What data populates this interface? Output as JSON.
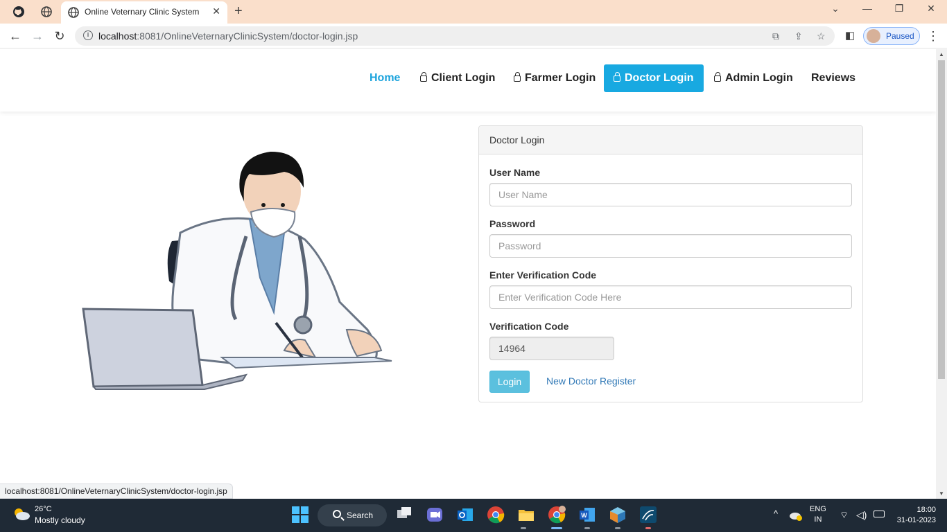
{
  "browser": {
    "tab_title": "Online Veternary Clinic System",
    "url_host": "localhost",
    "url_rest": ":8081/OnlineVeternaryClinicSystem/doctor-login.jsp",
    "profile_label": "Paused"
  },
  "nav": {
    "home": "Home",
    "client": "Client Login",
    "farmer": "Farmer Login",
    "doctor": "Doctor Login",
    "admin": "Admin Login",
    "reviews": "Reviews",
    "active_color": "#18a9e1"
  },
  "form": {
    "title": "Doctor Login",
    "username_label": "User Name",
    "username_placeholder": "User Name",
    "password_label": "Password",
    "password_placeholder": "Password",
    "enter_code_label": "Enter Verification Code",
    "enter_code_placeholder": "Enter Verification Code Here",
    "code_label": "Verification Code",
    "code_value": "14964",
    "login_label": "Login",
    "register_label": "New Doctor Register"
  },
  "status_url": "localhost:8081/OnlineVeternaryClinicSystem/doctor-login.jsp",
  "taskbar": {
    "temp": "26°C",
    "weather": "Mostly cloudy",
    "search": "Search",
    "lang": "ENG",
    "region": "IN",
    "time": "18:00",
    "date": "31-01-2023"
  }
}
